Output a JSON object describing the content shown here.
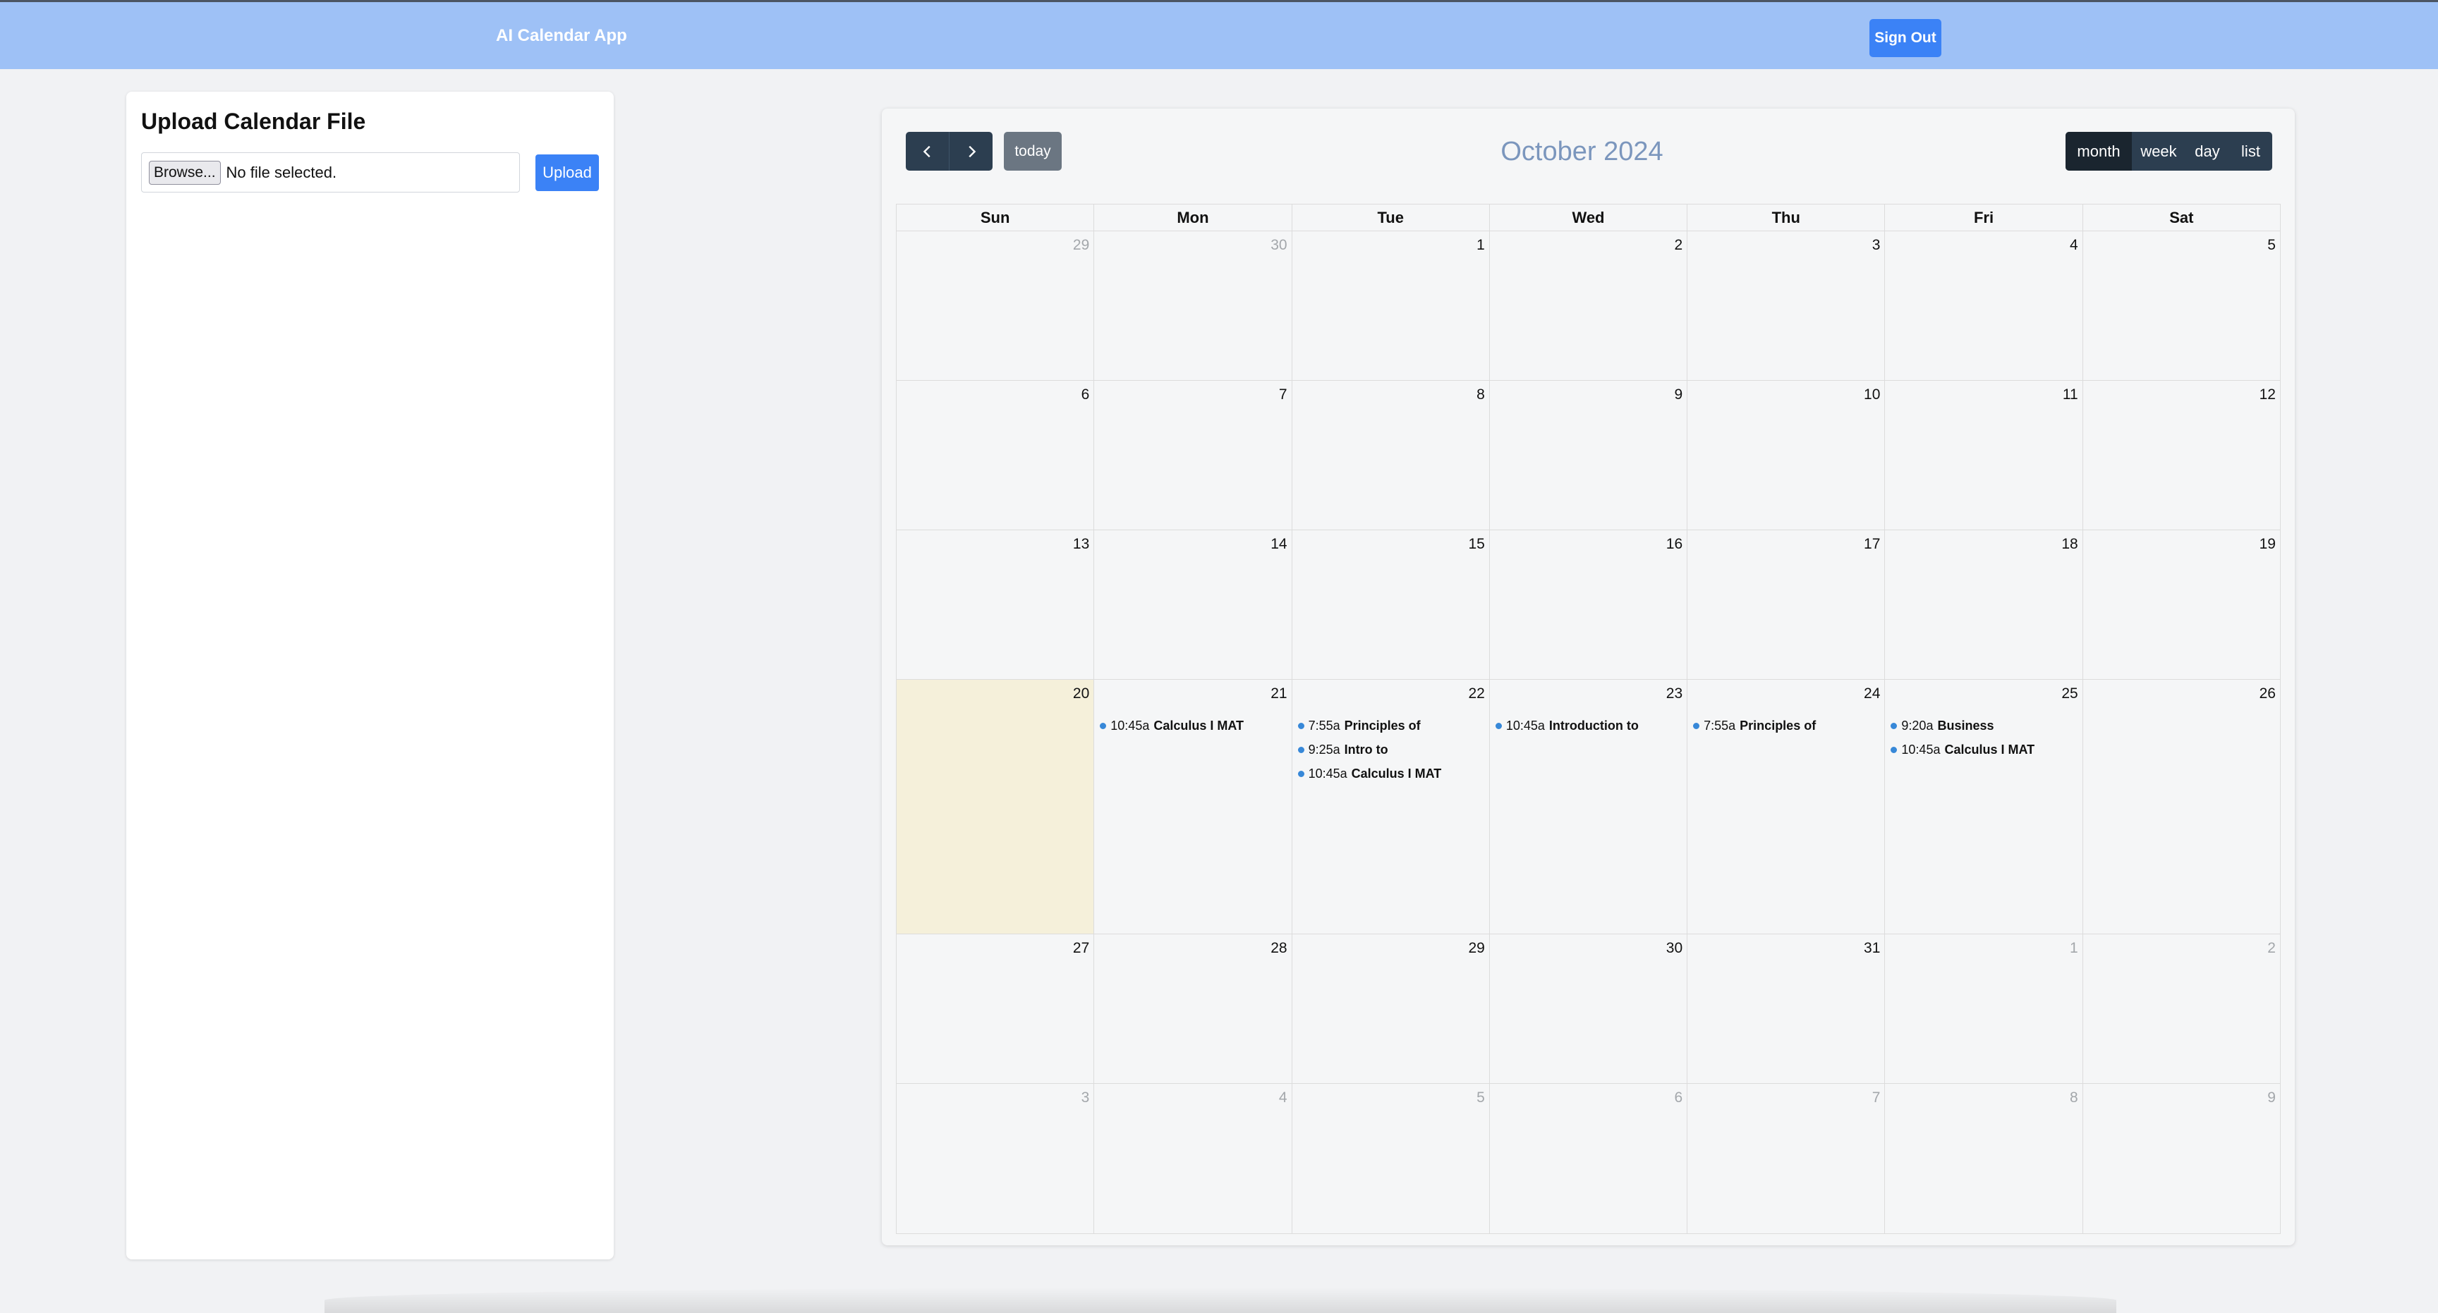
{
  "header": {
    "app_title": "AI Calendar App",
    "signout_label": "Sign Out"
  },
  "upload": {
    "title": "Upload Calendar File",
    "browse_label": "Browse...",
    "file_status": "No file selected.",
    "upload_label": "Upload"
  },
  "calendar": {
    "title": "October 2024",
    "prev_icon": "chevron-left-icon",
    "next_icon": "chevron-right-icon",
    "today_label": "today",
    "views": [
      {
        "label": "month",
        "active": true
      },
      {
        "label": "week",
        "active": false
      },
      {
        "label": "day",
        "active": false
      },
      {
        "label": "list",
        "active": false
      }
    ],
    "weekdays": [
      "Sun",
      "Mon",
      "Tue",
      "Wed",
      "Thu",
      "Fri",
      "Sat"
    ],
    "weeks": [
      [
        {
          "num": "29",
          "other": true
        },
        {
          "num": "30",
          "other": true
        },
        {
          "num": "1"
        },
        {
          "num": "2"
        },
        {
          "num": "3"
        },
        {
          "num": "4"
        },
        {
          "num": "5"
        }
      ],
      [
        {
          "num": "6"
        },
        {
          "num": "7"
        },
        {
          "num": "8"
        },
        {
          "num": "9"
        },
        {
          "num": "10"
        },
        {
          "num": "11"
        },
        {
          "num": "12"
        }
      ],
      [
        {
          "num": "13"
        },
        {
          "num": "14"
        },
        {
          "num": "15"
        },
        {
          "num": "16"
        },
        {
          "num": "17"
        },
        {
          "num": "18"
        },
        {
          "num": "19"
        }
      ],
      [
        {
          "num": "20",
          "today": true
        },
        {
          "num": "21",
          "events": [
            {
              "time": "10:45a",
              "title": "Calculus I MAT"
            }
          ]
        },
        {
          "num": "22",
          "events": [
            {
              "time": "7:55a",
              "title": "Principles of"
            },
            {
              "time": "9:25a",
              "title": "Intro to"
            },
            {
              "time": "10:45a",
              "title": "Calculus I MAT"
            }
          ]
        },
        {
          "num": "23",
          "events": [
            {
              "time": "10:45a",
              "title": "Introduction to"
            }
          ]
        },
        {
          "num": "24",
          "events": [
            {
              "time": "7:55a",
              "title": "Principles of"
            }
          ]
        },
        {
          "num": "25",
          "events": [
            {
              "time": "9:20a",
              "title": "Business"
            },
            {
              "time": "10:45a",
              "title": "Calculus I MAT"
            }
          ]
        },
        {
          "num": "26"
        }
      ],
      [
        {
          "num": "27"
        },
        {
          "num": "28"
        },
        {
          "num": "29"
        },
        {
          "num": "30"
        },
        {
          "num": "31"
        },
        {
          "num": "1",
          "other": true
        },
        {
          "num": "2",
          "other": true
        }
      ],
      [
        {
          "num": "3",
          "other": true
        },
        {
          "num": "4",
          "other": true
        },
        {
          "num": "5",
          "other": true
        },
        {
          "num": "6",
          "other": true
        },
        {
          "num": "7",
          "other": true
        },
        {
          "num": "8",
          "other": true
        },
        {
          "num": "9",
          "other": true
        }
      ]
    ]
  },
  "colors": {
    "header_bg": "#9ec1f6",
    "primary_button": "#3b82f6",
    "calendar_toolbar": "#2c3e50",
    "today_highlight": "#f5f0da",
    "event_dot": "#3788d8",
    "title_color": "#7b96bd"
  }
}
